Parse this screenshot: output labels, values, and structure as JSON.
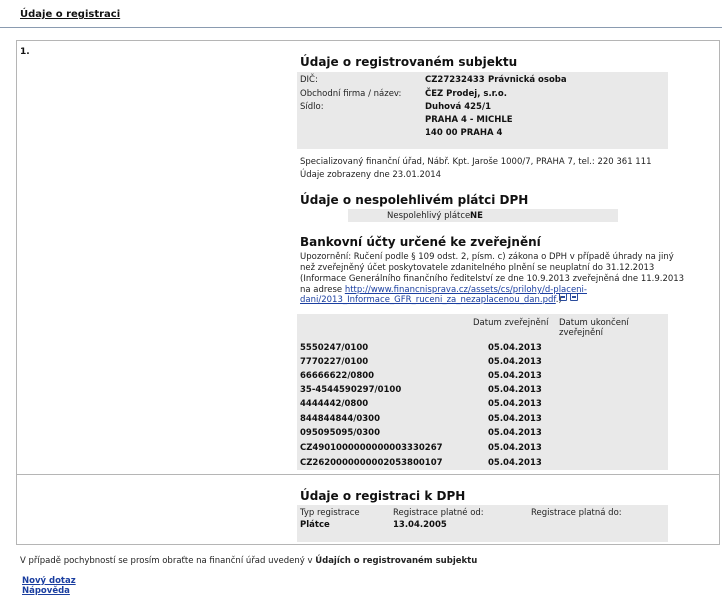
{
  "header": {
    "title": "Údaje o registraci"
  },
  "row_number": "1.",
  "subject": {
    "heading": "Údaje o registrovaném subjektu",
    "dic_label": "DIČ:",
    "dic_value": "CZ27232433",
    "dic_type": "Právnická osoba",
    "firm_label": "Obchodní firma / název:",
    "firm_value": "ČEZ Prodej, s.r.o.",
    "seat_label": "Sídlo:",
    "seat_line1": "Duhová 425/1",
    "seat_line2": "PRAHA 4 - MICHLE",
    "seat_line3": "140 00 PRAHA 4",
    "office_text": "Specializovaný finanční úřad, Nábř. Kpt. Jaroše 1000/7, PRAHA 7, tel.: 220 361 111",
    "date_text": "Údaje zobrazeny dne 23.01.2014"
  },
  "unreliable": {
    "heading": "Údaje o nespolehlivém plátci DPH",
    "label": "Nespolehlivý plátce:",
    "value": "NE"
  },
  "bank": {
    "heading": "Bankovní účty určené ke zveřejnění",
    "warning_line1": "Upozornění: Ručení podle § 109 odst. 2, písm. c) zákona o DPH v případě úhrady na jiný",
    "warning_line2": "než zveřejněný účet poskytovatele zdanitelného plnění se neuplatní do 31.12.2013",
    "warning_line3": "(Informace Generálního finančního ředitelství ze dne 10.9.2013 zveřejněná dne 11.9.2013",
    "warning_line4_prefix": "na adrese ",
    "link_line1": "http://www.financnisprava.cz/assets/cs/prilohy/d-placeni-",
    "link_line2": "dani/2013_Informace_GFR_ruceni_za_nezaplacenou_dan.pdf",
    "link_suffix": ".)",
    "col_published": "Datum zveřejnění",
    "col_end_line1": "Datum ukončení",
    "col_end_line2": "zveřejnění",
    "accounts": [
      {
        "account": "5550247/0100",
        "published": "05.04.2013"
      },
      {
        "account": "7770227/0100",
        "published": "05.04.2013"
      },
      {
        "account": "66666622/0800",
        "published": "05.04.2013"
      },
      {
        "account": "35-4544590297/0100",
        "published": "05.04.2013"
      },
      {
        "account": "4444442/0800",
        "published": "05.04.2013"
      },
      {
        "account": "844844844/0300",
        "published": "05.04.2013"
      },
      {
        "account": "095095095/0300",
        "published": "05.04.2013"
      },
      {
        "account": "CZ4901000000000003330267",
        "published": "05.04.2013"
      },
      {
        "account": "CZ2620000000002053800107",
        "published": "05.04.2013"
      }
    ]
  },
  "vat": {
    "heading": "Údaje o registraci k DPH",
    "col_type": "Typ registrace",
    "col_valid_from": "Registrace platné od:",
    "col_valid_to": "Registrace platná do:",
    "type_value": "Plátce",
    "valid_from_value": "13.04.2005"
  },
  "footer": {
    "note_text": "V případě pochybností se prosím obraťte na finanční úřad uvedený v ",
    "note_bold": "Údajích o registrovaném subjektu",
    "new_query": "Nový dotaz",
    "help": "Nápověda"
  }
}
